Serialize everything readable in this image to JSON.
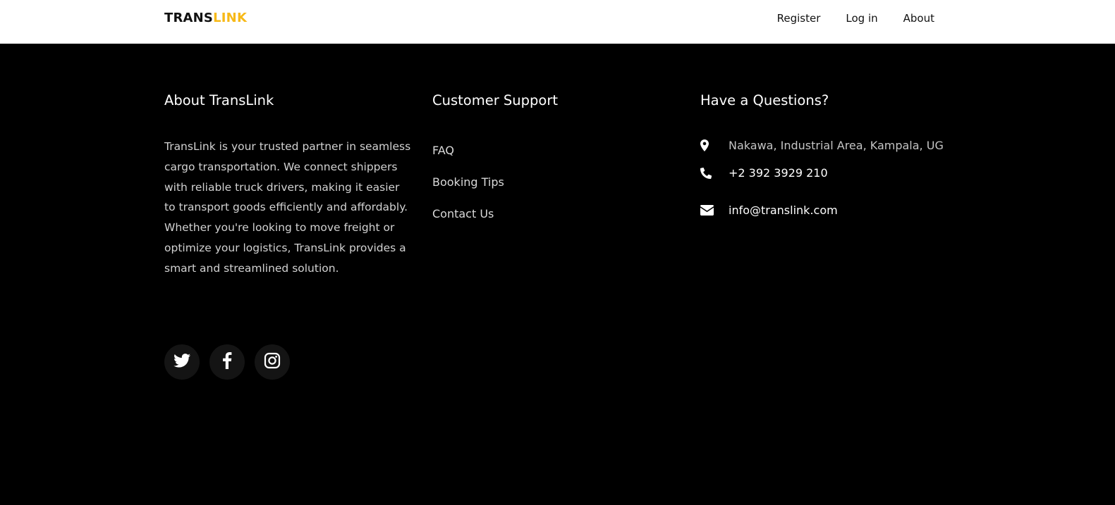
{
  "brand": {
    "part1": "TRANS",
    "part2": "LINK",
    "accent_color": "#f7b918"
  },
  "nav": {
    "links": [
      "Register",
      "Log in",
      "About"
    ]
  },
  "about": {
    "title": "About TransLink",
    "text": "TransLink is your trusted partner in seamless cargo transportation. We connect shippers with reliable truck drivers, making it easier to transport goods efficiently and affordably. Whether you're looking to move freight or optimize your logistics, TransLink provides a smart and streamlined solution.",
    "social_icons": [
      "twitter-icon",
      "facebook-icon",
      "instagram-icon"
    ]
  },
  "support": {
    "title": "Customer Support",
    "links": [
      "FAQ",
      "Booking Tips",
      "Contact Us"
    ]
  },
  "contact": {
    "title": "Have a Questions?",
    "address": "Nakawa, Industrial Area, Kampala, UG",
    "phone": "+2 392 3929 210",
    "email": "info@translink.com",
    "icons": [
      "map-marker-icon",
      "phone-icon",
      "envelope-icon"
    ]
  }
}
